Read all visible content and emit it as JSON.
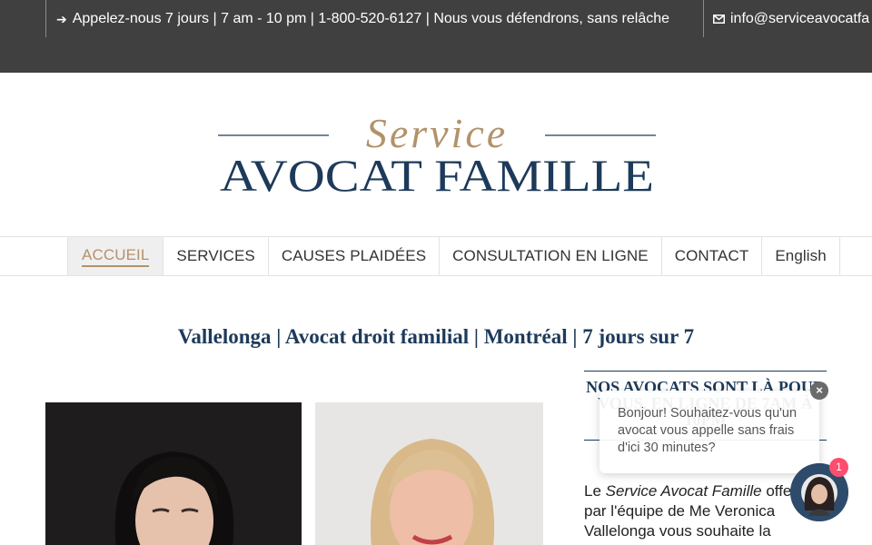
{
  "topbar": {
    "phone_icon": "arrow-right-icon",
    "phone_text": "Appelez-nous 7 jours | 7 am - 10 pm | 1-800-520-6127 | Nous vous défendrons, sans relâche",
    "email_icon": "envelope-icon",
    "email_text": "info@serviceavocatfa"
  },
  "logo": {
    "script": "Service",
    "wordmark": "AVOCAT FAMILLE",
    "colors": {
      "gold": "#b3926a",
      "navy": "#1d3a5a"
    }
  },
  "nav": {
    "items": [
      {
        "label": "ACCUEIL",
        "active": true
      },
      {
        "label": "SERVICES",
        "active": false
      },
      {
        "label": "CAUSES PLAIDÉES",
        "active": false
      },
      {
        "label": "CONSULTATION EN LIGNE",
        "active": false
      },
      {
        "label": "CONTACT",
        "active": false
      },
      {
        "label": "English",
        "active": false
      }
    ]
  },
  "page": {
    "title": "Vallelonga | Avocat droit familial | Montréal | 7 jours sur 7"
  },
  "sidebar": {
    "heading": "Nos avocats sont là pour vous, en ligne de 7am à 10pm",
    "text_before": "Le ",
    "text_em": "Service Avocat Famille",
    "text_after": " offert par l'équipe de Me Veronica Vallelonga vous souhaite la"
  },
  "chat": {
    "message": "Bonjour! Souhaitez-vous qu'un avocat vous appelle sans frais d'ici 30 minutes?",
    "close_label": "×",
    "badge_count": "1"
  },
  "colors": {
    "topbar_bg": "#404040",
    "accent_gold": "#b3926a",
    "navy": "#1d3a5a",
    "badge": "#ff4d6d"
  }
}
